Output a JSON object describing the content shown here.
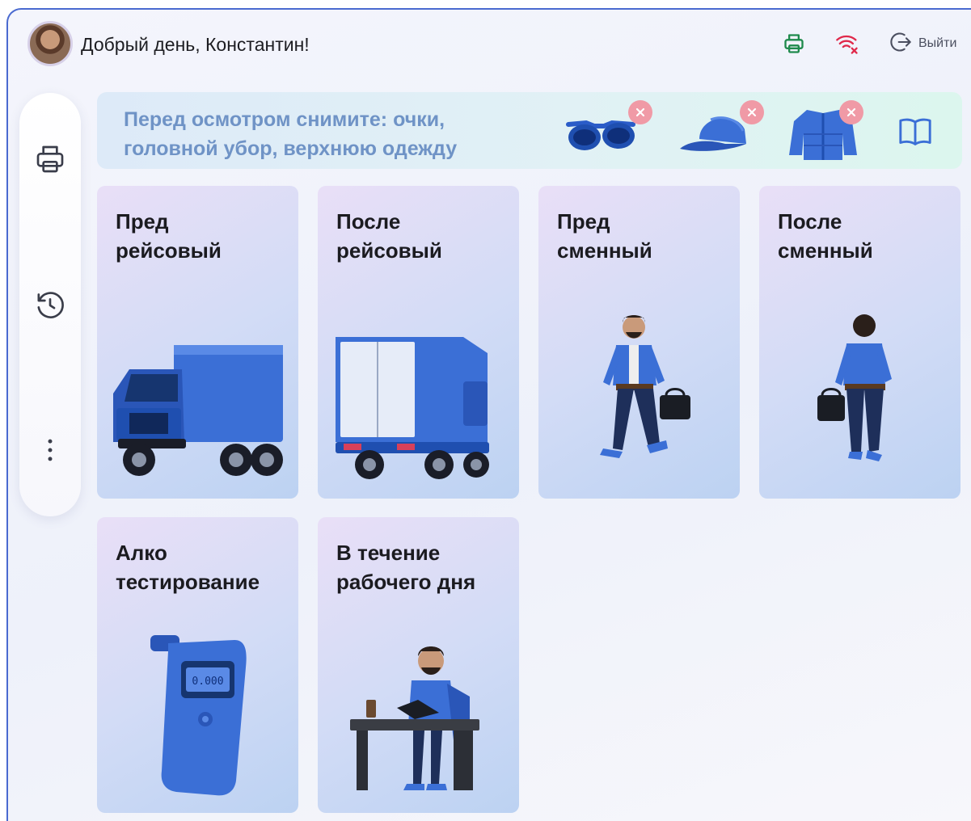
{
  "header": {
    "greeting": "Добрый день, Константин!",
    "icons": [
      "printer-icon",
      "wifi-off-icon",
      "logout-icon"
    ],
    "logout_label": "Выйти"
  },
  "sidebar": {
    "items": [
      {
        "icon": "printer-icon"
      },
      {
        "icon": "history-icon"
      },
      {
        "icon": "more-vertical-icon"
      }
    ]
  },
  "banner": {
    "text": "Перед осмотром снимите: очки, головной убор, верхнюю одежду",
    "items": [
      "glasses",
      "cap",
      "jacket"
    ],
    "book_icon": "book-icon"
  },
  "cards": [
    {
      "title": "Пред\nрейсовый",
      "art": "truck-front"
    },
    {
      "title": "После\nрейсовый",
      "art": "truck-back"
    },
    {
      "title": "Пред\nсменный",
      "art": "man-walking-front"
    },
    {
      "title": "После\nсменный",
      "art": "man-walking-back"
    },
    {
      "title": "Алко\nтестирование",
      "art": "breathalyzer"
    },
    {
      "title": "В течение\nрабочего дня",
      "art": "man-at-desk"
    }
  ],
  "breathalyzer_display": "0.000",
  "colors": {
    "accent_blue": "#3b6fd6",
    "banner_text": "#6f93c6",
    "printer_green": "#1f8a4c",
    "wifi_red": "#e0284a",
    "badge_pink": "#f09aa6"
  }
}
